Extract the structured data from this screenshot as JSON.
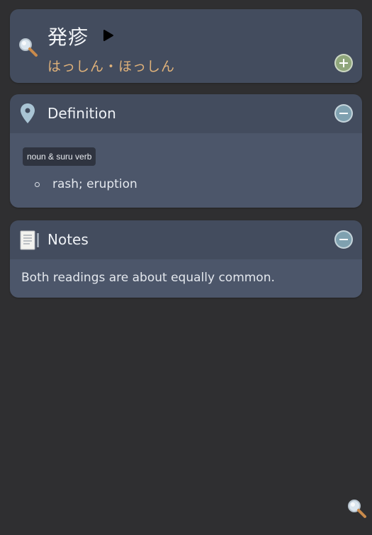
{
  "entry": {
    "word": "発疹",
    "reading": "はっしん・ほっしん"
  },
  "definition": {
    "title": "Definition",
    "part_of_speech": "noun & suru verb",
    "senses": [
      "rash; eruption"
    ]
  },
  "notes": {
    "title": "Notes",
    "text": "Both readings are about equally common."
  },
  "icons": {
    "search": "search-icon",
    "play": "play-icon",
    "add": "plus-circle-icon",
    "collapse": "minus-circle-icon",
    "pin": "map-pin-icon",
    "notes": "notepad-icon"
  },
  "colors": {
    "background": "#2f2f31",
    "card_header": "#434c5e",
    "card_body": "#4c566a",
    "reading": "#e0b27a",
    "add_button": "#8fa67b",
    "collapse_button": "#7fa1b0"
  }
}
